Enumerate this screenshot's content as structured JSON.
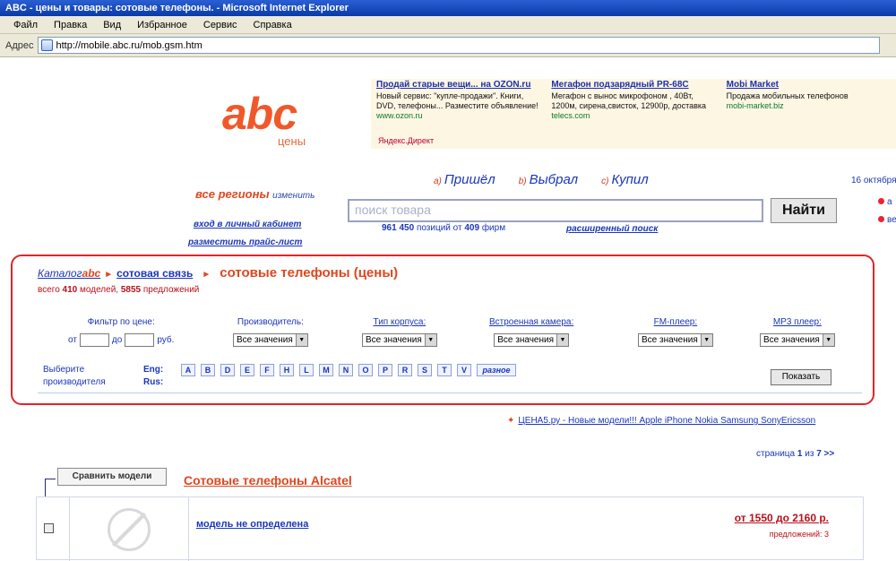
{
  "window": {
    "title": "ABC - цены и товары: сотовые телефоны. - Microsoft Internet Explorer"
  },
  "menu": [
    "Файл",
    "Правка",
    "Вид",
    "Избранное",
    "Сервис",
    "Справка"
  ],
  "address": {
    "label": "Адрес",
    "url": "http://mobile.abc.ru/mob.gsm.htm"
  },
  "logo": {
    "text": "abc",
    "subtitle": "цены"
  },
  "ads": [
    {
      "title": "Продай старые вещи... на OZON.ru",
      "text": "Новый сервис: \"купле-продажи\". Книги, DVD, телефоны... Разместите объявление!",
      "url": "www.ozon.ru"
    },
    {
      "title": "Мегафон подзарядный PR-68C",
      "text": "Мегафон с вынос микрофоном , 40Вт, 1200м, сирена,свисток, 12900р, доставка",
      "url": "telecs.com"
    },
    {
      "title": "Mobi Market",
      "text": "Продажа мобильных телефонов",
      "url": "mobi-market.biz"
    }
  ],
  "ads_footer": "Яндекс.Директ",
  "steps": [
    {
      "num": "a)",
      "label": "Пришёл"
    },
    {
      "num": "b)",
      "label": "Выбрал"
    },
    {
      "num": "c)",
      "label": "Купил"
    }
  ],
  "side": {
    "date": "16 октября",
    "link1": "а",
    "link2": "ве"
  },
  "regions": {
    "label": "все регионы",
    "change": "изменить"
  },
  "search": {
    "placeholder": "поиск товара",
    "button": "Найти",
    "positions": "961 450",
    "positions_text": "позиций от",
    "firms": "409",
    "firms_text": "фирм",
    "advanced": "расширенный поиск"
  },
  "cabinet_link": "вход в личный кабинет",
  "pricelist_link": "разместить прайс-лист",
  "breadcrumb": {
    "catalog": "Каталог",
    "brand": "abc",
    "section": "сотовая связь",
    "current": "сотовые телефоны (цены)"
  },
  "totals": {
    "prefix": "всего",
    "models": "410",
    "models_text": "моделей,",
    "offers": "5855",
    "offers_text": "предложений"
  },
  "filters": {
    "price": {
      "label": "Фильтр по цене:",
      "from": "от",
      "to": "до",
      "currency": "руб."
    },
    "selects": [
      {
        "label": "Производитель:",
        "value": "Все значения",
        "underline": false
      },
      {
        "label": "Тип корпуса:",
        "value": "Все значения",
        "underline": true
      },
      {
        "label": "Встроенная камера:",
        "value": "Все значения",
        "underline": true
      },
      {
        "label": "FM-плеер:",
        "value": "Все значения",
        "underline": true
      },
      {
        "label": "MP3 плеер:",
        "value": "Все значения",
        "underline": true
      }
    ]
  },
  "maker": {
    "label1": "Выберите",
    "label2": "производителя",
    "eng": "Eng:",
    "rus": "Rus:",
    "letters": [
      "A",
      "B",
      "D",
      "E",
      "F",
      "H",
      "L",
      "M",
      "N",
      "O",
      "P",
      "R",
      "S",
      "T",
      "V"
    ],
    "other": "разное"
  },
  "show_button": "Показать",
  "news_link": "ЦЕНА5.ру - Новые модели!!! Apple iPhone Nokia Samsung SonyEricsson",
  "pager": {
    "prefix": "страница",
    "current": "1",
    "of": "из",
    "total": "7",
    "next": ">>"
  },
  "compare_button": "Сравнить модели",
  "section_title": "Сотовые телефоны Alcatel",
  "result": {
    "name": "модель не определена",
    "price": "от 1550 до 2160 р.",
    "offers": "предложений: 3"
  },
  "colors": {
    "accent": "#e0461f",
    "link": "#1a36b8",
    "highlight_border": "#e0242a"
  }
}
